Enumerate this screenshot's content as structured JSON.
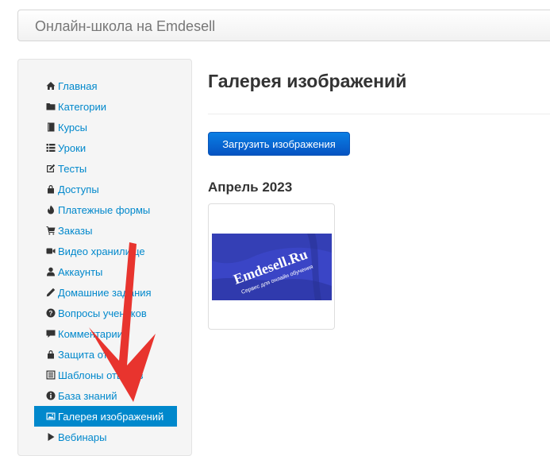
{
  "header": {
    "brand": "Онлайн-школа на Emdesell"
  },
  "sidebar": {
    "items": [
      {
        "label": "Главная",
        "icon": "home-icon"
      },
      {
        "label": "Категории",
        "icon": "folder-icon"
      },
      {
        "label": "Курсы",
        "icon": "book-icon"
      },
      {
        "label": "Уроки",
        "icon": "list-icon"
      },
      {
        "label": "Тесты",
        "icon": "edit-icon"
      },
      {
        "label": "Доступы",
        "icon": "lock-icon"
      },
      {
        "label": "Платежные формы",
        "icon": "fire-icon"
      },
      {
        "label": "Заказы",
        "icon": "cart-icon"
      },
      {
        "label": "Видео хранилище",
        "icon": "video-icon"
      },
      {
        "label": "Аккаунты",
        "icon": "user-icon"
      },
      {
        "label": "Домашние задания",
        "icon": "pencil-icon"
      },
      {
        "label": "Вопросы учеников",
        "icon": "question-icon"
      },
      {
        "label": "Комментарии",
        "icon": "comment-icon"
      },
      {
        "label": "Защита от",
        "icon": "lock-icon"
      },
      {
        "label": "Шаблоны ответов",
        "icon": "template-icon"
      },
      {
        "label": "База знаний",
        "icon": "info-icon"
      },
      {
        "label": "Галерея изображений",
        "icon": "picture-icon",
        "active": true
      },
      {
        "label": "Вебинары",
        "icon": "play-icon"
      }
    ]
  },
  "main": {
    "title": "Галерея изображений",
    "upload_label": "Загрузить изображения",
    "month": "Апрель 2023",
    "thumbnail": {
      "brand_text": "Emdesell.Ru",
      "caption_text": "Сервис для онлайн обучения"
    }
  },
  "colors": {
    "link": "#0088cc",
    "active_bg": "#0088cc",
    "button_top": "#0a7fe4",
    "button_bottom": "#0653c2",
    "arrow": "#e8342e",
    "thumb_bg": "#3a45c6"
  }
}
